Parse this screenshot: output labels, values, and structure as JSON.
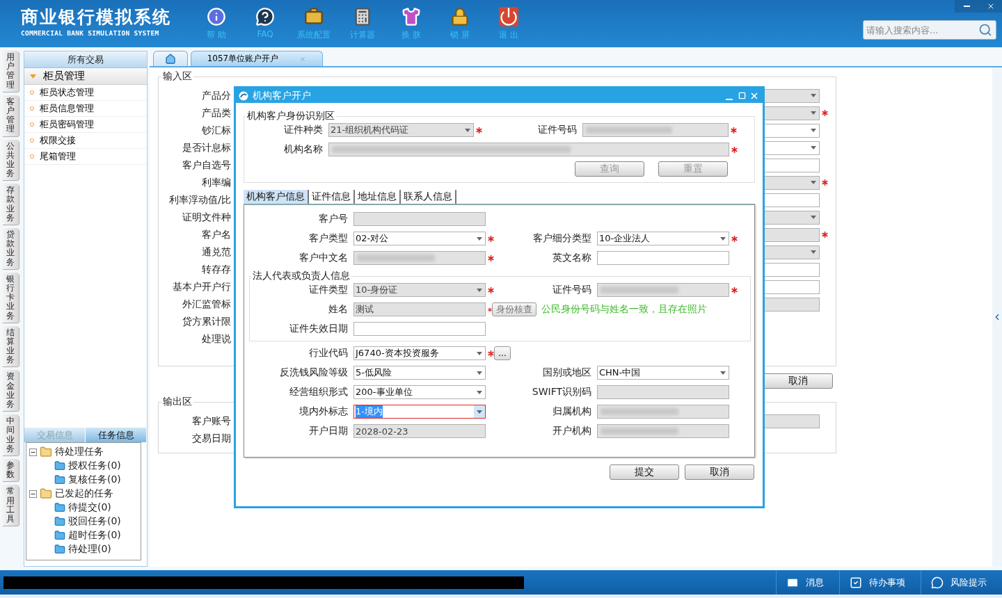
{
  "header": {
    "title": "商业银行模拟系统",
    "subtitle": "COMMERCIAL BANK SIMULATION SYSTEM",
    "tools": [
      {
        "label": "帮 助"
      },
      {
        "label": "FAQ"
      },
      {
        "label": "系统配置"
      },
      {
        "label": "计算器"
      },
      {
        "label": "换 肤"
      },
      {
        "label": "锁 屏"
      },
      {
        "label": "退 出"
      }
    ],
    "search": {
      "placeholder": "请输入搜索内容..."
    }
  },
  "side_tabs": [
    "用户管理",
    "客户管理",
    "公共业务",
    "存款业务",
    "贷款业务",
    "银行卡业务",
    "结算业务",
    "资金业务",
    "中间业务",
    "参数",
    "常用工具"
  ],
  "menu": {
    "title": "所有交易",
    "groups": [
      {
        "label": "柜员管理",
        "expanded": true,
        "items": [
          "柜员状态管理",
          "柜员信息管理",
          "柜员密码管理",
          "权限交接",
          "尾箱管理"
        ]
      }
    ]
  },
  "task_panel": {
    "tabs": [
      {
        "label": "交易信息",
        "selected": false
      },
      {
        "label": "任务信息",
        "selected": true
      }
    ],
    "tree": [
      {
        "label": "待处理任务",
        "expanded": true,
        "children": [
          {
            "label": "授权任务(0)"
          },
          {
            "label": "复核任务(0)"
          }
        ]
      },
      {
        "label": "已发起的任务",
        "expanded": true,
        "children": [
          {
            "label": "待提交(0)"
          },
          {
            "label": "驳回任务(0)"
          },
          {
            "label": "超时任务(0)"
          },
          {
            "label": "待处理(0)"
          }
        ]
      }
    ]
  },
  "content_tabs": [
    {
      "kind": "home",
      "selected": false
    },
    {
      "kind": "page",
      "label": "1057单位账户开户",
      "selected": true
    }
  ],
  "input_area": {
    "title": "输入区",
    "rows": [
      {
        "label": "产品分",
        "field": {
          "kind": "select",
          "disabled": true,
          "required": false
        }
      },
      {
        "label": "产品类",
        "field": {
          "kind": "select",
          "disabled": true,
          "required": true
        }
      },
      {
        "label": "钞汇标",
        "field": {
          "kind": "select",
          "disabled": false,
          "required": false
        }
      },
      {
        "label": "是否计息标",
        "field": {
          "kind": "select",
          "disabled": false,
          "required": false
        }
      },
      {
        "label": "客户自选号",
        "field": {
          "kind": "input",
          "disabled": false,
          "required": false
        }
      },
      {
        "label": "利率编",
        "field": {
          "kind": "select",
          "disabled": true,
          "required": true
        }
      },
      {
        "label": "利率浮动值/比",
        "field": {
          "kind": "input",
          "disabled": false,
          "required": false
        }
      },
      {
        "label": "证明文件种",
        "field": {
          "kind": "select",
          "disabled": true,
          "required": false
        }
      },
      {
        "label": "客户名",
        "field": {
          "kind": "input",
          "disabled": true,
          "required": true
        }
      },
      {
        "label": "通兑范",
        "field": {
          "kind": "select",
          "disabled": true,
          "required": false
        }
      },
      {
        "label": "转存存",
        "field": {
          "kind": "input",
          "disabled": false,
          "required": false
        }
      },
      {
        "label": "基本户开户行",
        "field": {
          "kind": "input",
          "disabled": false,
          "required": false
        }
      },
      {
        "label": "外汇监管标",
        "field": {
          "kind": "input",
          "disabled": true,
          "required": false
        }
      },
      {
        "label": "贷方累计限"
      },
      {
        "label": "处理说"
      }
    ]
  },
  "cancel_button": "取消",
  "output_area": {
    "title": "输出区",
    "rows": [
      {
        "label": "客户账号",
        "field": {
          "kind": "input",
          "disabled": true,
          "required": false
        }
      },
      {
        "label": "交易日期"
      }
    ]
  },
  "dialog": {
    "title": "机构客户开户",
    "ident": {
      "title": "机构客户身份识别区",
      "rows": [
        {
          "fields": [
            {
              "label": "证件种类",
              "kind": "select",
              "value": "21-组织机构代码证",
              "disabled": true,
              "required": true,
              "masked": false,
              "focused": false
            },
            {
              "label": "证件号码",
              "kind": "input",
              "disabled": true,
              "required": true,
              "masked": true,
              "focused": false
            }
          ]
        },
        {
          "fields": [
            {
              "label": "机构名称",
              "kind": "input",
              "disabled": true,
              "required": true,
              "masked": true,
              "focused": false
            }
          ]
        }
      ],
      "buttons": [
        {
          "label": "查询",
          "disabled": true
        },
        {
          "label": "重置",
          "disabled": true
        }
      ]
    },
    "tabs": [
      {
        "label": "机构客户信息",
        "selected": true
      },
      {
        "label": "证件信息",
        "selected": false
      },
      {
        "label": "地址信息",
        "selected": false
      },
      {
        "label": "联系人信息",
        "selected": false
      }
    ],
    "rows": [
      {
        "kind": "pair",
        "fields": [
          {
            "label": "客户号",
            "kind": "input",
            "disabled": true,
            "required": false,
            "masked": false,
            "focused": false
          }
        ]
      },
      {
        "kind": "pair",
        "fields": [
          {
            "label": "客户类型",
            "kind": "select",
            "value": "02-对公",
            "disabled": false,
            "required": true,
            "masked": false,
            "focused": false
          },
          {
            "label": "客户细分类型",
            "kind": "select",
            "value": "10-企业法人",
            "disabled": false,
            "required": true,
            "masked": false,
            "focused": false
          }
        ]
      },
      {
        "kind": "pair",
        "fields": [
          {
            "label": "客户中文名",
            "kind": "input",
            "disabled": true,
            "required": true,
            "masked": true,
            "focused": false
          },
          {
            "label": "英文名称",
            "kind": "input",
            "disabled": false,
            "required": false,
            "masked": false,
            "focused": false
          }
        ]
      },
      {
        "kind": "group",
        "title": "法人代表或负责人信息",
        "rows": [
          {
            "kind": "pair",
            "fields": [
              {
                "label": "证件类型",
                "kind": "select",
                "value": "10-身份证",
                "disabled": true,
                "required": true,
                "masked": false,
                "focused": false
              },
              {
                "label": "证件号码",
                "kind": "input",
                "disabled": true,
                "required": true,
                "masked": true,
                "focused": false
              }
            ]
          },
          {
            "kind": "pair",
            "fields": [
              {
                "label": "姓名",
                "kind": "input",
                "value": "测试",
                "disabled": true,
                "required": true,
                "masked": false,
                "focused": false,
                "action": {
                  "label": "身份核查",
                  "disabled": true
                },
                "message": "公民身份号码与姓名一致，且存在照片"
              }
            ]
          },
          {
            "kind": "pair",
            "fields": [
              {
                "label": "证件失效日期",
                "kind": "input",
                "disabled": false,
                "required": false,
                "masked": false,
                "focused": false
              }
            ]
          }
        ]
      },
      {
        "kind": "pair",
        "fields": [
          {
            "label": "行业代码",
            "kind": "select",
            "value": "J6740-资本投资服务",
            "disabled": false,
            "required": true,
            "masked": false,
            "focused": false,
            "more": "..."
          }
        ]
      },
      {
        "kind": "pair",
        "fields": [
          {
            "label": "反洗钱风险等级",
            "kind": "select",
            "value": "5-低风险",
            "disabled": false,
            "required": false,
            "masked": false,
            "focused": false
          },
          {
            "label": "国别或地区",
            "kind": "select",
            "value": "CHN-中国",
            "disabled": false,
            "required": false,
            "masked": false,
            "focused": false
          }
        ]
      },
      {
        "kind": "pair",
        "fields": [
          {
            "label": "经营组织形式",
            "kind": "select",
            "value": "200-事业单位",
            "disabled": false,
            "required": false,
            "masked": false,
            "focused": false
          },
          {
            "label": "SWIFT识别码",
            "kind": "input",
            "disabled": true,
            "required": false,
            "masked": false,
            "focused": false
          }
        ]
      },
      {
        "kind": "pair",
        "fields": [
          {
            "label": "境内外标志",
            "kind": "select",
            "value": "1-境内",
            "disabled": false,
            "required": false,
            "masked": false,
            "focused": true
          },
          {
            "label": "归属机构",
            "kind": "input",
            "disabled": true,
            "required": false,
            "masked": true,
            "focused": false
          }
        ]
      },
      {
        "kind": "pair",
        "fields": [
          {
            "label": "开户日期",
            "kind": "input",
            "value": "2028-02-23",
            "disabled": true,
            "required": false,
            "masked": false,
            "focused": false
          },
          {
            "label": "开户机构",
            "kind": "input",
            "disabled": true,
            "required": false,
            "masked": true,
            "focused": false
          }
        ]
      }
    ],
    "buttons": [
      {
        "label": "提交"
      },
      {
        "label": "取消"
      }
    ]
  },
  "status_bar": {
    "items": [
      {
        "label": "消息"
      },
      {
        "label": "待办事项"
      },
      {
        "label": "风险提示"
      }
    ]
  }
}
